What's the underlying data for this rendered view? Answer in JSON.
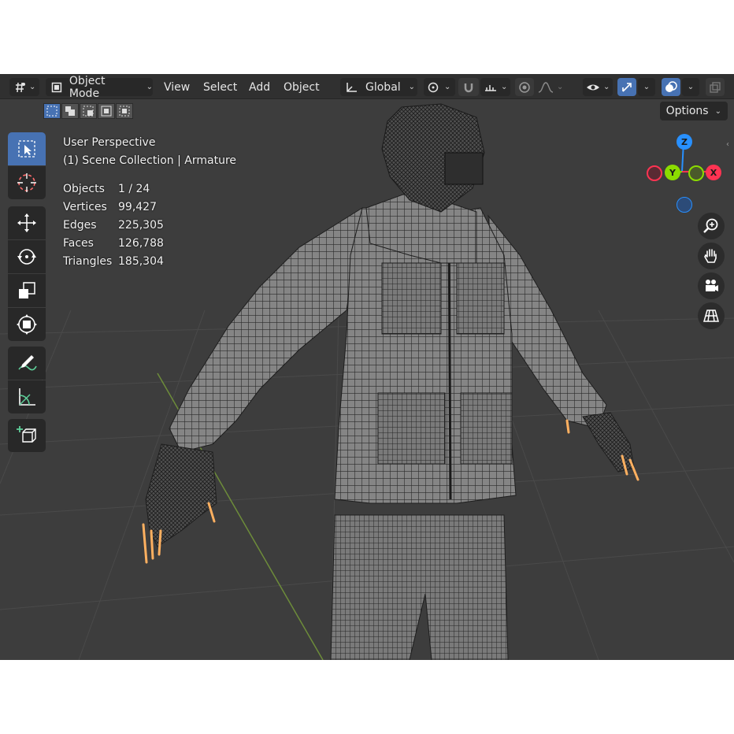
{
  "header": {
    "mode_label": "Object Mode",
    "menus": [
      "View",
      "Select",
      "Add",
      "Object"
    ],
    "orientation_label": "Global"
  },
  "subheader": {
    "options_label": "Options"
  },
  "viewport": {
    "view_name": "User Perspective",
    "collection": "(1) Scene Collection | Armature",
    "stats": [
      {
        "label": "Objects",
        "value": "1 / 24"
      },
      {
        "label": "Vertices",
        "value": "99,427"
      },
      {
        "label": "Edges",
        "value": "225,305"
      },
      {
        "label": "Faces",
        "value": "126,788"
      },
      {
        "label": "Triangles",
        "value": "185,304"
      }
    ]
  },
  "gizmo": {
    "z_label": "Z",
    "y_label": "Y",
    "x_label": "X"
  },
  "icons": {
    "editor_type": "editor-type-icon",
    "mode": "object-mode-icon",
    "toolbar": [
      "select-box-icon",
      "cursor-icon",
      "move-icon",
      "rotate-icon",
      "scale-icon",
      "transform-icon",
      "annotate-icon",
      "measure-icon",
      "add-cube-icon"
    ],
    "nav": [
      "zoom-icon",
      "pan-hand-icon",
      "camera-icon",
      "grid-view-icon"
    ]
  },
  "colors": {
    "accent": "#4772b3",
    "axis_x": "#ff3352",
    "axis_y": "#8bdc00",
    "axis_z": "#2890ff",
    "bone": "#ffb060"
  }
}
